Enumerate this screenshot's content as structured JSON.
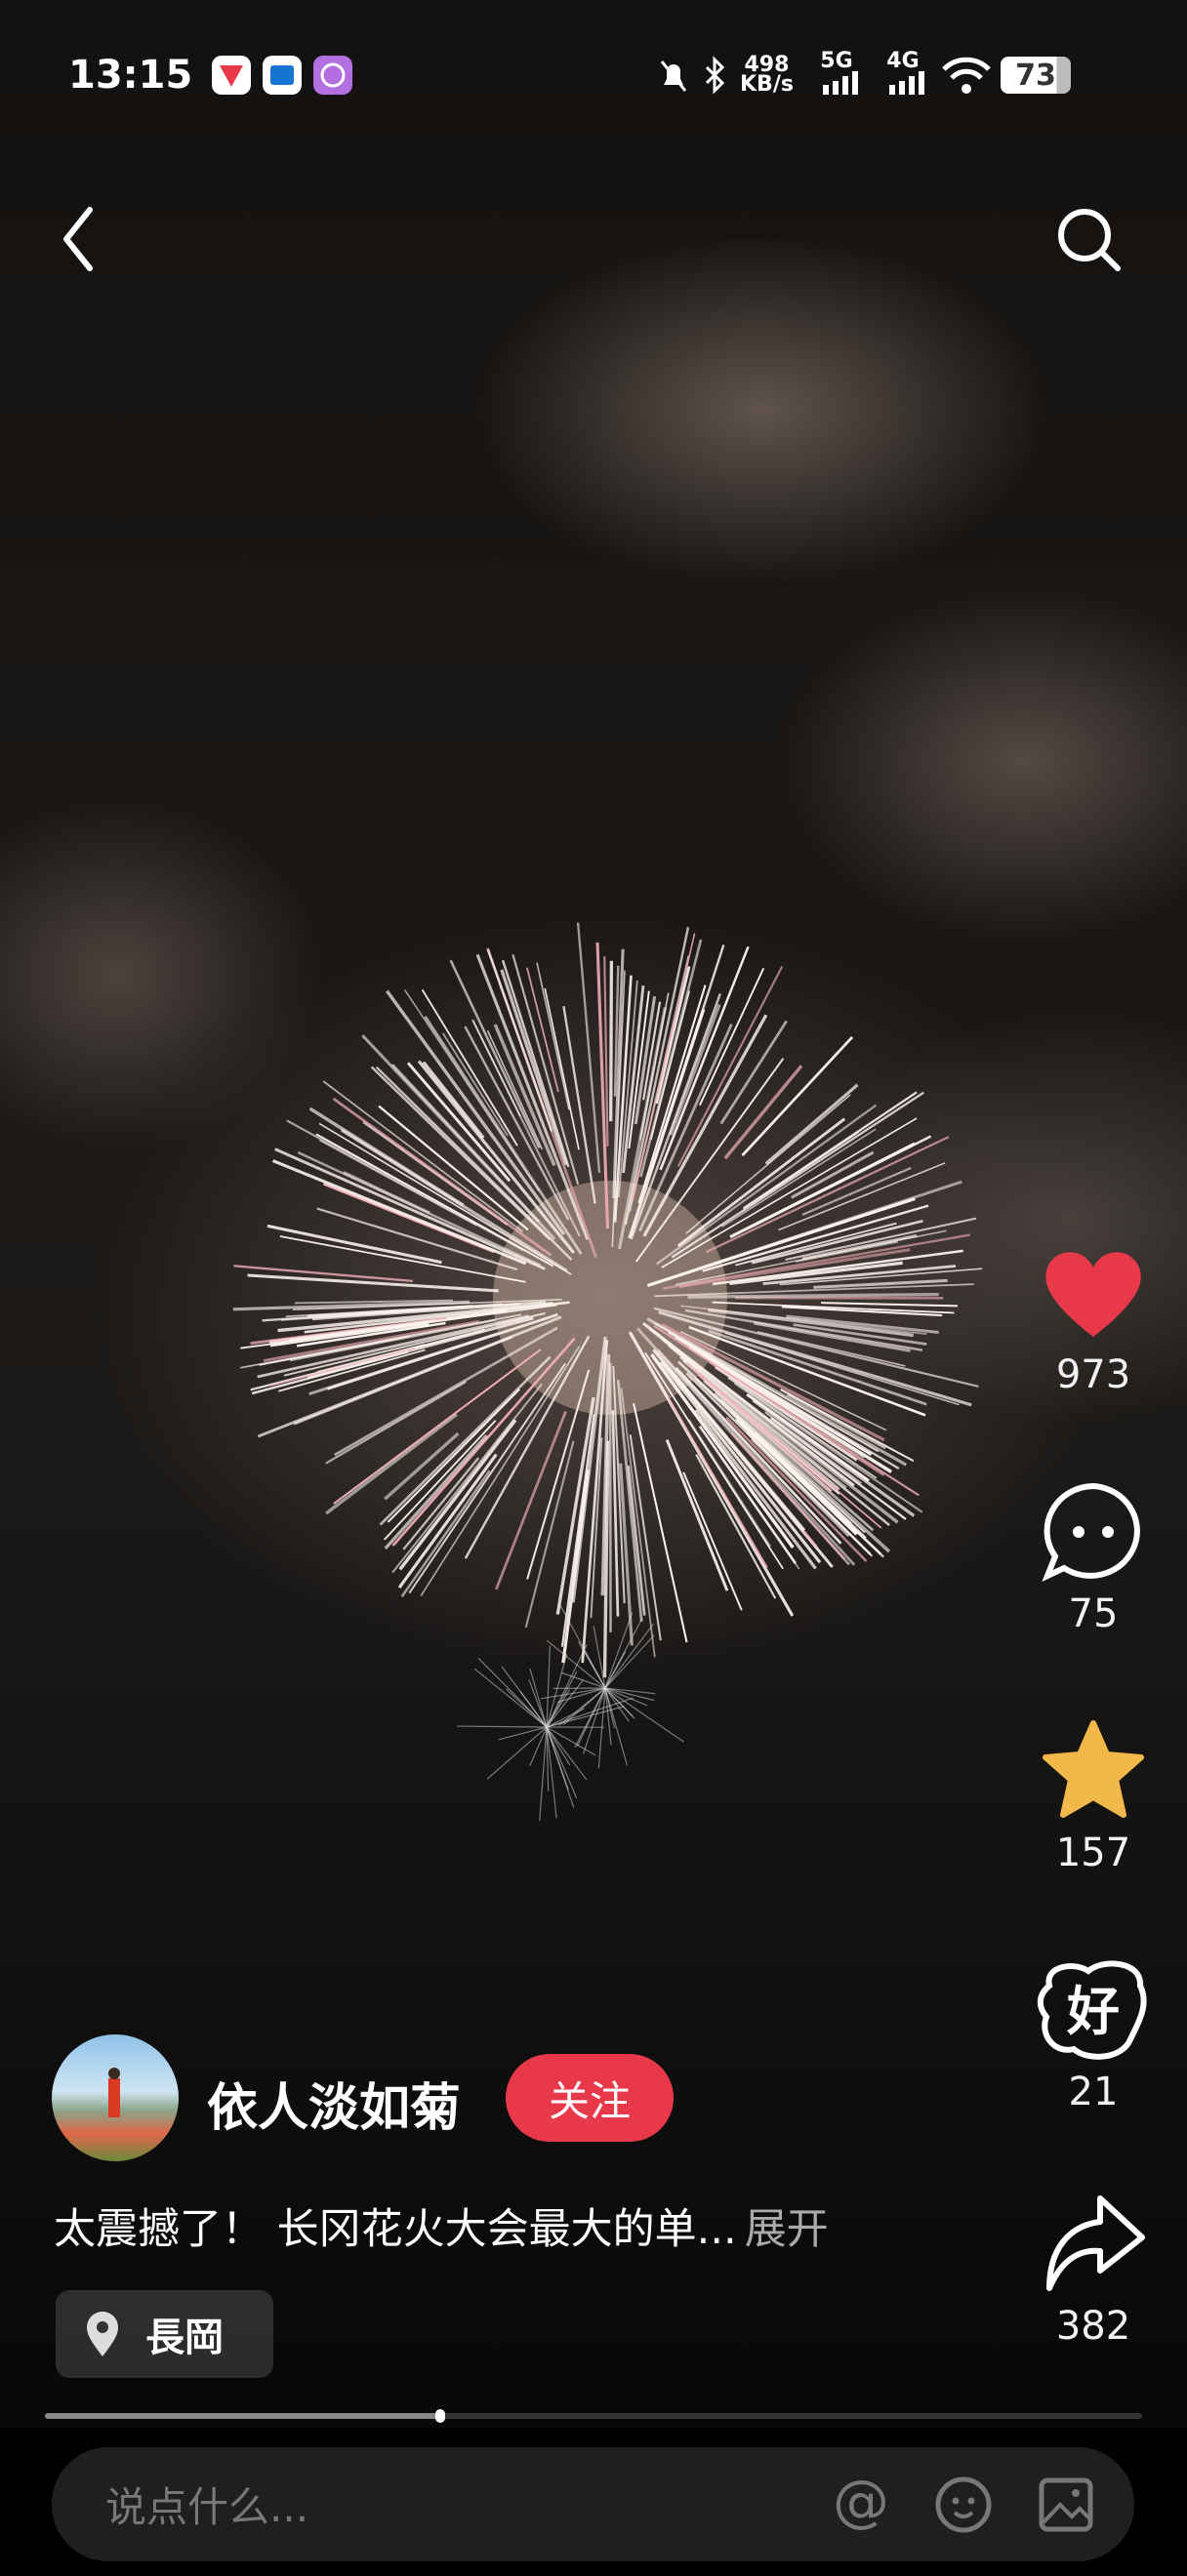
{
  "status_bar": {
    "time": "13:15",
    "net_speed_value": "498",
    "net_speed_unit": "KB/s",
    "signal1": "5G",
    "signal2": "4G",
    "battery": "73"
  },
  "author": {
    "name": "依人淡如菊",
    "follow_label": "关注"
  },
  "caption": {
    "text": "太震撼了！ 长冈花火大会最大的单...",
    "expand_label": "展开"
  },
  "location": {
    "label": "長岡"
  },
  "actions": {
    "likes": "973",
    "comments": "75",
    "favorites": "157",
    "good": "21",
    "shares": "382"
  },
  "playback": {
    "progress_percent": 36
  },
  "comment_input": {
    "placeholder": "说点什么..."
  },
  "colors": {
    "like": "#e8394a",
    "favorite": "#f3b84a",
    "follow": "#e8394a"
  }
}
